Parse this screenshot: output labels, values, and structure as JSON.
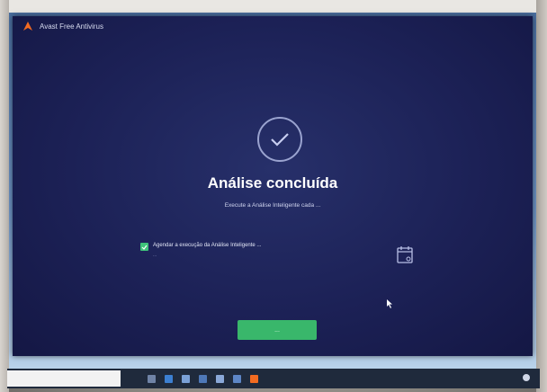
{
  "window": {
    "app_title": "Avast Free Antivirus",
    "title_links": [
      "",
      ""
    ]
  },
  "scan_result": {
    "headline": "Análise concluída",
    "subline": "Execute a Análise Inteligente cada ...",
    "check_icon": "check-circle-icon"
  },
  "schedule": {
    "checked": true,
    "label": "Agendar a execução da Análise Inteligente ...",
    "description": "..."
  },
  "actions": {
    "ok_label": "..."
  },
  "taskbar": {
    "search_placeholder": "",
    "icons": [
      "task-view-icon",
      "edge-icon",
      "explorer-icon",
      "store-icon",
      "mail-icon",
      "photos-icon",
      "avast-icon"
    ],
    "tray_text": ""
  },
  "colors": {
    "window_bg": "#1c2156",
    "accent_green": "#39b76b",
    "avast_orange": "#f36b21"
  }
}
